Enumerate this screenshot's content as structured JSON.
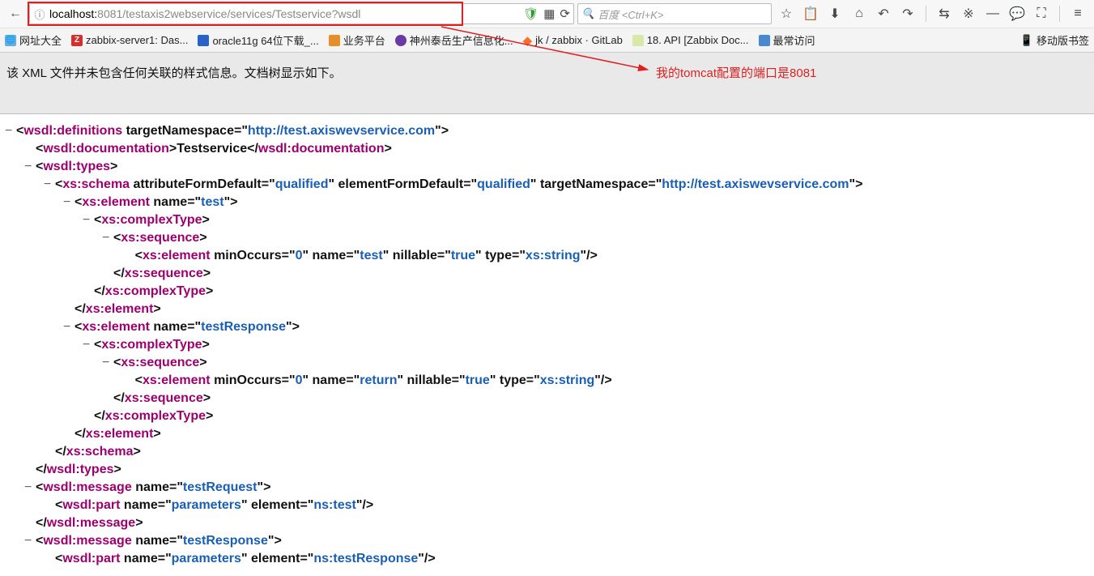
{
  "url": {
    "host": "localhost:",
    "rest": "8081/testaxis2webservice/services/Testservice?wsdl"
  },
  "search": {
    "placeholder": "百度 <Ctrl+K>"
  },
  "toolbar_icons": {
    "back": "←",
    "info": "ⓘ",
    "shield": "🛡",
    "reader": "▦",
    "reload": "⟳",
    "star": "☆",
    "clip": "📋",
    "download": "⬇",
    "home": "⌂",
    "undo": "↶",
    "redo": "↷",
    "sync": "⇆",
    "dev": "※",
    "dash": "—",
    "chat": "💬",
    "expand": "⛶",
    "menu": "≡"
  },
  "bookmarks": [
    {
      "label": "网址大全",
      "name": "bm-all"
    },
    {
      "label": "zabbix-server1: Das...",
      "name": "bm-zabbix"
    },
    {
      "label": "oracle11g 64位下载_...",
      "name": "bm-oracle"
    },
    {
      "label": "业务平台",
      "name": "bm-biz"
    },
    {
      "label": "神州泰岳生产信息化...",
      "name": "bm-shenzhou"
    },
    {
      "label": "jk / zabbix · GitLab",
      "name": "bm-gitlab"
    },
    {
      "label": "18. API [Zabbix Doc...",
      "name": "bm-api"
    },
    {
      "label": "最常访问",
      "name": "bm-most"
    }
  ],
  "bookmarks_right": "移动版书签",
  "info_text": "该 XML 文件并未包含任何关联的样式信息。文档树显示如下。",
  "annotation": "我的tomcat配置的端口是8081",
  "xml_lines": [
    {
      "ind": 0,
      "toggle": "−",
      "parts": [
        [
          "br",
          "<"
        ],
        [
          "tag",
          "wsdl:definitions"
        ],
        [
          "sp",
          " "
        ],
        [
          "attrname",
          "targetNamespace"
        ],
        [
          "attreq",
          "="
        ],
        [
          "br",
          "\""
        ],
        [
          "attrval",
          "http://test.axiswevservice.com"
        ],
        [
          "br",
          "\""
        ],
        [
          "br",
          ">"
        ]
      ]
    },
    {
      "ind": 1,
      "toggle": "",
      "parts": [
        [
          "br",
          "<"
        ],
        [
          "tag",
          "wsdl:documentation"
        ],
        [
          "br",
          ">"
        ],
        [
          "txt",
          "Testservice"
        ],
        [
          "br",
          "</"
        ],
        [
          "tag",
          "wsdl:documentation"
        ],
        [
          "br",
          ">"
        ]
      ]
    },
    {
      "ind": 1,
      "toggle": "−",
      "parts": [
        [
          "br",
          "<"
        ],
        [
          "tag",
          "wsdl:types"
        ],
        [
          "br",
          ">"
        ]
      ]
    },
    {
      "ind": 2,
      "toggle": "−",
      "parts": [
        [
          "br",
          "<"
        ],
        [
          "tag",
          "xs:schema"
        ],
        [
          "sp",
          " "
        ],
        [
          "attrname",
          "attributeFormDefault"
        ],
        [
          "attreq",
          "="
        ],
        [
          "br",
          "\""
        ],
        [
          "attrval",
          "qualified"
        ],
        [
          "br",
          "\" "
        ],
        [
          "attrname",
          "elementFormDefault"
        ],
        [
          "attreq",
          "="
        ],
        [
          "br",
          "\""
        ],
        [
          "attrval",
          "qualified"
        ],
        [
          "br",
          "\" "
        ],
        [
          "attrname",
          "targetNamespace"
        ],
        [
          "attreq",
          "="
        ],
        [
          "br",
          "\""
        ],
        [
          "attrval",
          "http://test.axiswevservice.com"
        ],
        [
          "br",
          "\""
        ],
        [
          "br",
          ">"
        ]
      ]
    },
    {
      "ind": 3,
      "toggle": "−",
      "parts": [
        [
          "br",
          "<"
        ],
        [
          "tag",
          "xs:element"
        ],
        [
          "sp",
          " "
        ],
        [
          "attrname",
          "name"
        ],
        [
          "attreq",
          "="
        ],
        [
          "br",
          "\""
        ],
        [
          "attrval",
          "test"
        ],
        [
          "br",
          "\""
        ],
        [
          "br",
          ">"
        ]
      ]
    },
    {
      "ind": 4,
      "toggle": "−",
      "parts": [
        [
          "br",
          "<"
        ],
        [
          "tag",
          "xs:complexType"
        ],
        [
          "br",
          ">"
        ]
      ]
    },
    {
      "ind": 5,
      "toggle": "−",
      "parts": [
        [
          "br",
          "<"
        ],
        [
          "tag",
          "xs:sequence"
        ],
        [
          "br",
          ">"
        ]
      ]
    },
    {
      "ind": 5,
      "toggle": "",
      "parts": [
        [
          "sp",
          "      "
        ],
        [
          "br",
          "<"
        ],
        [
          "tag",
          "xs:element"
        ],
        [
          "sp",
          " "
        ],
        [
          "attrname",
          "minOccurs"
        ],
        [
          "attreq",
          "="
        ],
        [
          "br",
          "\""
        ],
        [
          "attrval",
          "0"
        ],
        [
          "br",
          "\" "
        ],
        [
          "attrname",
          "name"
        ],
        [
          "attreq",
          "="
        ],
        [
          "br",
          "\""
        ],
        [
          "attrval",
          "test"
        ],
        [
          "br",
          "\" "
        ],
        [
          "attrname",
          "nillable"
        ],
        [
          "attreq",
          "="
        ],
        [
          "br",
          "\""
        ],
        [
          "attrval",
          "true"
        ],
        [
          "br",
          "\" "
        ],
        [
          "attrname",
          "type"
        ],
        [
          "attreq",
          "="
        ],
        [
          "br",
          "\""
        ],
        [
          "attrval",
          "xs:string"
        ],
        [
          "br",
          "\""
        ],
        [
          "br",
          "/>"
        ]
      ]
    },
    {
      "ind": 5,
      "toggle": "",
      "parts": [
        [
          "br",
          "</"
        ],
        [
          "tag",
          "xs:sequence"
        ],
        [
          "br",
          ">"
        ]
      ]
    },
    {
      "ind": 4,
      "toggle": "",
      "parts": [
        [
          "br",
          "</"
        ],
        [
          "tag",
          "xs:complexType"
        ],
        [
          "br",
          ">"
        ]
      ]
    },
    {
      "ind": 3,
      "toggle": "",
      "parts": [
        [
          "br",
          "</"
        ],
        [
          "tag",
          "xs:element"
        ],
        [
          "br",
          ">"
        ]
      ]
    },
    {
      "ind": 3,
      "toggle": "−",
      "parts": [
        [
          "br",
          "<"
        ],
        [
          "tag",
          "xs:element"
        ],
        [
          "sp",
          " "
        ],
        [
          "attrname",
          "name"
        ],
        [
          "attreq",
          "="
        ],
        [
          "br",
          "\""
        ],
        [
          "attrval",
          "testResponse"
        ],
        [
          "br",
          "\""
        ],
        [
          "br",
          ">"
        ]
      ]
    },
    {
      "ind": 4,
      "toggle": "−",
      "parts": [
        [
          "br",
          "<"
        ],
        [
          "tag",
          "xs:complexType"
        ],
        [
          "br",
          ">"
        ]
      ]
    },
    {
      "ind": 5,
      "toggle": "−",
      "parts": [
        [
          "br",
          "<"
        ],
        [
          "tag",
          "xs:sequence"
        ],
        [
          "br",
          ">"
        ]
      ]
    },
    {
      "ind": 5,
      "toggle": "",
      "parts": [
        [
          "sp",
          "      "
        ],
        [
          "br",
          "<"
        ],
        [
          "tag",
          "xs:element"
        ],
        [
          "sp",
          " "
        ],
        [
          "attrname",
          "minOccurs"
        ],
        [
          "attreq",
          "="
        ],
        [
          "br",
          "\""
        ],
        [
          "attrval",
          "0"
        ],
        [
          "br",
          "\" "
        ],
        [
          "attrname",
          "name"
        ],
        [
          "attreq",
          "="
        ],
        [
          "br",
          "\""
        ],
        [
          "attrval",
          "return"
        ],
        [
          "br",
          "\" "
        ],
        [
          "attrname",
          "nillable"
        ],
        [
          "attreq",
          "="
        ],
        [
          "br",
          "\""
        ],
        [
          "attrval",
          "true"
        ],
        [
          "br",
          "\" "
        ],
        [
          "attrname",
          "type"
        ],
        [
          "attreq",
          "="
        ],
        [
          "br",
          "\""
        ],
        [
          "attrval",
          "xs:string"
        ],
        [
          "br",
          "\""
        ],
        [
          "br",
          "/>"
        ]
      ]
    },
    {
      "ind": 5,
      "toggle": "",
      "parts": [
        [
          "br",
          "</"
        ],
        [
          "tag",
          "xs:sequence"
        ],
        [
          "br",
          ">"
        ]
      ]
    },
    {
      "ind": 4,
      "toggle": "",
      "parts": [
        [
          "br",
          "</"
        ],
        [
          "tag",
          "xs:complexType"
        ],
        [
          "br",
          ">"
        ]
      ]
    },
    {
      "ind": 3,
      "toggle": "",
      "parts": [
        [
          "br",
          "</"
        ],
        [
          "tag",
          "xs:element"
        ],
        [
          "br",
          ">"
        ]
      ]
    },
    {
      "ind": 2,
      "toggle": "",
      "parts": [
        [
          "br",
          "</"
        ],
        [
          "tag",
          "xs:schema"
        ],
        [
          "br",
          ">"
        ]
      ]
    },
    {
      "ind": 1,
      "toggle": "",
      "parts": [
        [
          "br",
          "</"
        ],
        [
          "tag",
          "wsdl:types"
        ],
        [
          "br",
          ">"
        ]
      ]
    },
    {
      "ind": 1,
      "toggle": "−",
      "parts": [
        [
          "br",
          "<"
        ],
        [
          "tag",
          "wsdl:message"
        ],
        [
          "sp",
          " "
        ],
        [
          "attrname",
          "name"
        ],
        [
          "attreq",
          "="
        ],
        [
          "br",
          "\""
        ],
        [
          "attrval",
          "testRequest"
        ],
        [
          "br",
          "\""
        ],
        [
          "br",
          ">"
        ]
      ]
    },
    {
      "ind": 2,
      "toggle": "",
      "parts": [
        [
          "br",
          "<"
        ],
        [
          "tag",
          "wsdl:part"
        ],
        [
          "sp",
          " "
        ],
        [
          "attrname",
          "name"
        ],
        [
          "attreq",
          "="
        ],
        [
          "br",
          "\""
        ],
        [
          "attrval",
          "parameters"
        ],
        [
          "br",
          "\" "
        ],
        [
          "attrname",
          "element"
        ],
        [
          "attreq",
          "="
        ],
        [
          "br",
          "\""
        ],
        [
          "attrval",
          "ns:test"
        ],
        [
          "br",
          "\""
        ],
        [
          "br",
          "/>"
        ]
      ]
    },
    {
      "ind": 1,
      "toggle": "",
      "parts": [
        [
          "br",
          "</"
        ],
        [
          "tag",
          "wsdl:message"
        ],
        [
          "br",
          ">"
        ]
      ]
    },
    {
      "ind": 1,
      "toggle": "−",
      "parts": [
        [
          "br",
          "<"
        ],
        [
          "tag",
          "wsdl:message"
        ],
        [
          "sp",
          " "
        ],
        [
          "attrname",
          "name"
        ],
        [
          "attreq",
          "="
        ],
        [
          "br",
          "\""
        ],
        [
          "attrval",
          "testResponse"
        ],
        [
          "br",
          "\""
        ],
        [
          "br",
          ">"
        ]
      ]
    },
    {
      "ind": 2,
      "toggle": "",
      "parts": [
        [
          "br",
          "<"
        ],
        [
          "tag",
          "wsdl:part"
        ],
        [
          "sp",
          " "
        ],
        [
          "attrname",
          "name"
        ],
        [
          "attreq",
          "="
        ],
        [
          "br",
          "\""
        ],
        [
          "attrval",
          "parameters"
        ],
        [
          "br",
          "\" "
        ],
        [
          "attrname",
          "element"
        ],
        [
          "attreq",
          "="
        ],
        [
          "br",
          "\""
        ],
        [
          "attrval",
          "ns:testResponse"
        ],
        [
          "br",
          "\""
        ],
        [
          "br",
          "/>"
        ]
      ]
    }
  ]
}
